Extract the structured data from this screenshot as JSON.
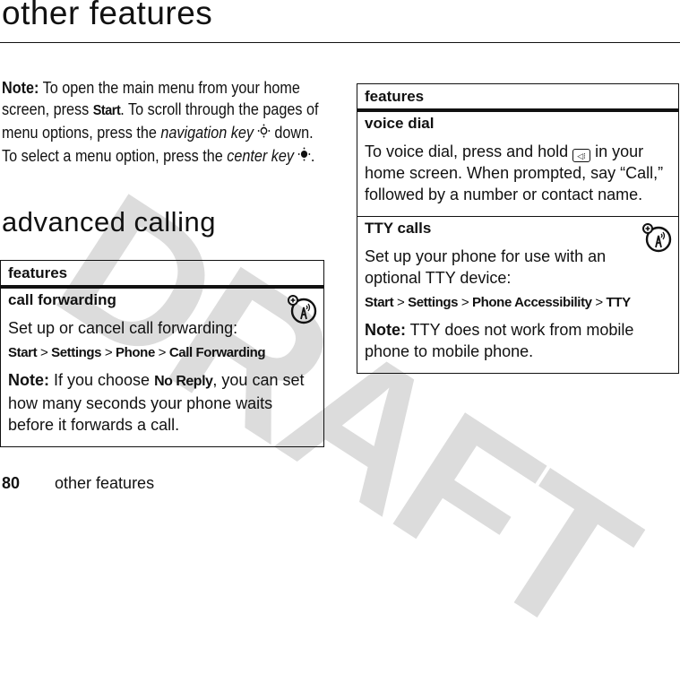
{
  "watermark": "DRAFT",
  "page": {
    "title": "other features",
    "intro_note": {
      "label": "Note:",
      "text_1": " To open the main menu from your home screen, press ",
      "key_start": "Start",
      "text_2": ". To scroll through the pages of menu options, press the ",
      "nav_key": "navigation key",
      "nav_key_glyph": "·ọ·",
      "text_3": " down. To select a menu option, press the ",
      "center_key": "center key",
      "center_key_glyph": "·◆·",
      "text_4": "."
    },
    "section_title": "advanced calling"
  },
  "left_table": {
    "header": "features",
    "rows": [
      {
        "title": "call forwarding",
        "icon": "network-feature-icon",
        "text": "Set up or cancel call forwarding:",
        "path": [
          "Start",
          "Settings",
          "Phone",
          "Call Forwarding"
        ],
        "path_separator": ">",
        "note_label": "Note:",
        "note_text_1": " If you choose ",
        "note_key": "No Reply",
        "note_text_2": ", you can set how many seconds your phone waits before it forwards a call."
      }
    ]
  },
  "right_table": {
    "header": "features",
    "rows": [
      {
        "title": "voice dial",
        "text_1": "To voice dial, press and hold ",
        "key_icon": "voice-key-icon",
        "key_glyph": "◁⁝",
        "text_2": " in your home screen. When prompted, say “Call,” followed by a number or contact name."
      },
      {
        "title": "TTY calls",
        "icon": "network-feature-icon",
        "text": "Set up your phone for use with an optional TTY device:",
        "path": [
          "Start",
          "Settings",
          "Phone Accessibility",
          "TTY"
        ],
        "path_separator": ">",
        "note_label": "Note:",
        "note_text": " TTY does not work from mobile phone to mobile phone."
      }
    ]
  },
  "footer": {
    "page_number": "80",
    "section": "other features"
  }
}
